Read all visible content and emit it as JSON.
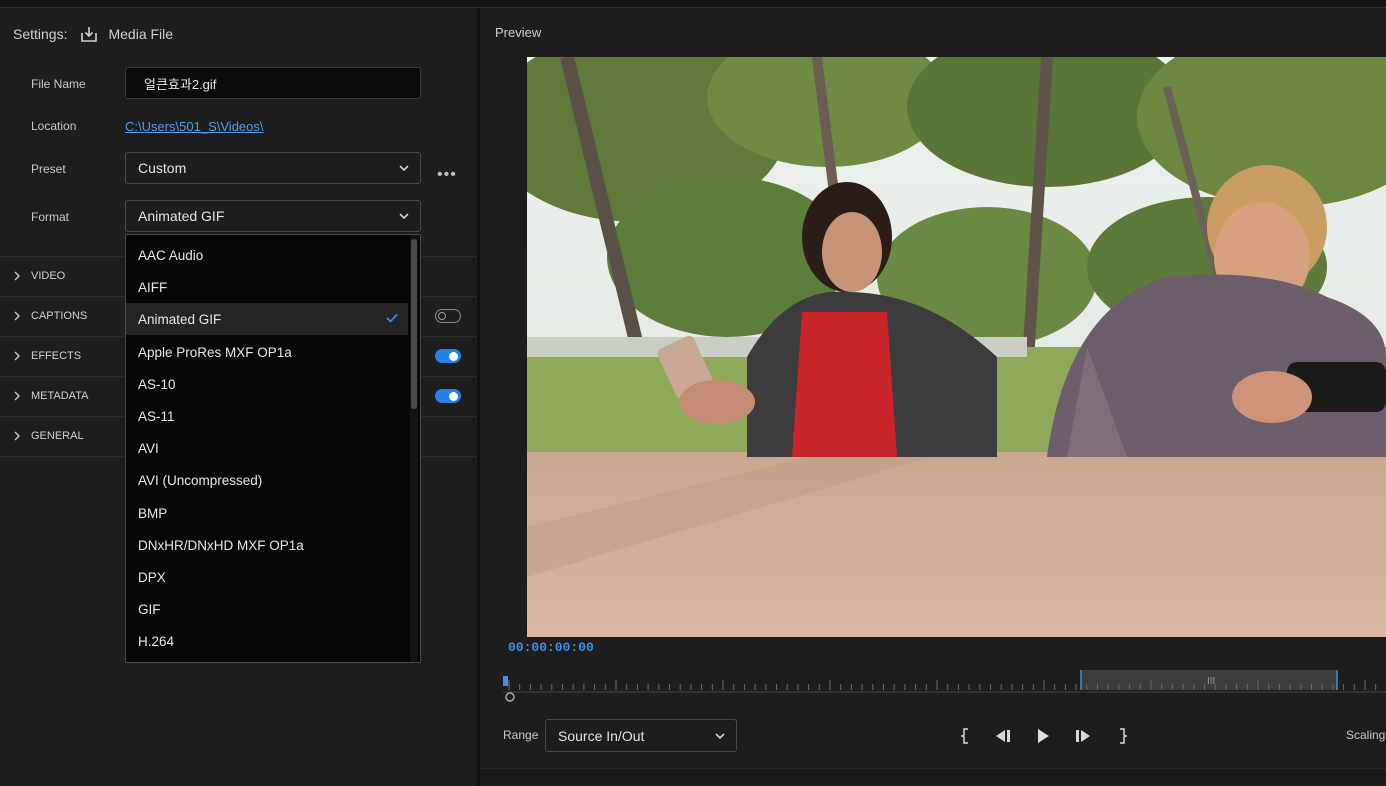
{
  "settings": {
    "label": "Settings:",
    "source": "Media File",
    "file_name_label": "File Name",
    "file_name_value": "얼큰효과2.gif",
    "location_label": "Location",
    "location_value": "C:\\Users\\501_S\\Videos\\",
    "preset_label": "Preset",
    "preset_value": "Custom",
    "format_label": "Format",
    "format_value": "Animated GIF"
  },
  "sections": [
    {
      "label": "VIDEO"
    },
    {
      "label": "CAPTIONS",
      "toggle": "off"
    },
    {
      "label": "EFFECTS",
      "toggle": "on"
    },
    {
      "label": "METADATA",
      "toggle": "on"
    },
    {
      "label": "GENERAL"
    }
  ],
  "format_options": [
    "AAC Audio",
    "AIFF",
    "Animated GIF",
    "Apple ProRes MXF OP1a",
    "AS-10",
    "AS-11",
    "AVI",
    "AVI (Uncompressed)",
    "BMP",
    "DNxHR/DNxHD MXF OP1a",
    "DPX",
    "GIF",
    "H.264"
  ],
  "format_selected": "Animated GIF",
  "preview": {
    "title": "Preview",
    "timecode": "00:00:00:00",
    "range_label": "Range",
    "range_value": "Source In/Out",
    "scaling_label": "Scaling"
  },
  "colors": {
    "accent": "#2680eb",
    "timecode": "#3d8ee8",
    "link": "#4f9ef0",
    "panel_bg": "#1d1d1d"
  },
  "icons": {
    "export": "download-tray-icon",
    "chevron": "chevron-down-icon",
    "section": "chevron-right-icon",
    "more": "more-horizontal-icon",
    "check": "checkmark-icon",
    "mark_in": "mark-in-icon",
    "step_back": "step-back-icon",
    "play": "play-icon",
    "step_forward": "step-forward-icon",
    "mark_out": "mark-out-icon"
  }
}
